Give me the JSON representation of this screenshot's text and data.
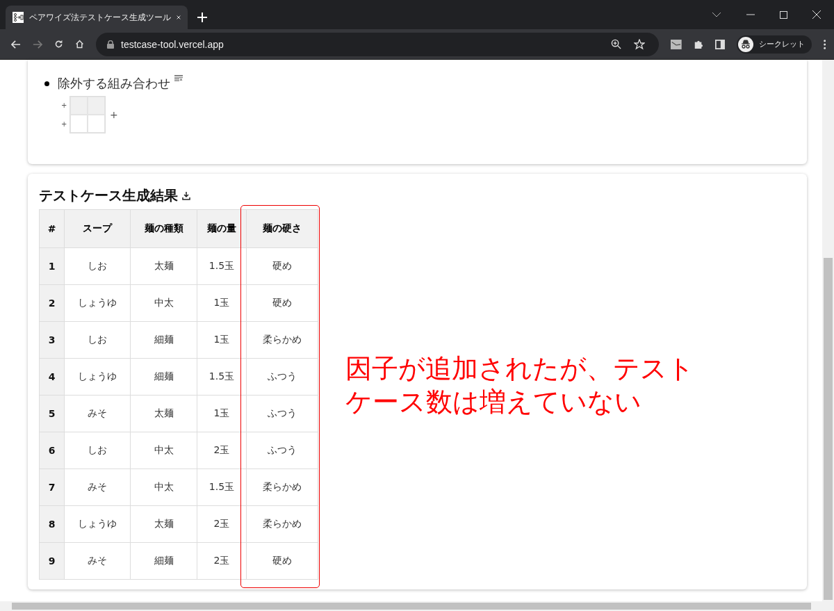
{
  "browser": {
    "tab_title": "ペアワイズ法テストケース生成ツール",
    "url": "testcase-tool.vercel.app",
    "profile": "シークレット"
  },
  "exclusions": {
    "title": "除外する組み合わせ",
    "add_symbol": "+"
  },
  "results": {
    "title": "テストケース生成結果",
    "columns": [
      {
        "label": "#",
        "highlighted": false
      },
      {
        "label": "スープ",
        "highlighted": false
      },
      {
        "label": "麺の種類",
        "highlighted": false
      },
      {
        "label": "麺の量",
        "highlighted": false
      },
      {
        "label": "麺の硬さ",
        "highlighted": true
      }
    ],
    "rows": [
      [
        "1",
        "しお",
        "太麺",
        "1.5玉",
        "硬め"
      ],
      [
        "2",
        "しょうゆ",
        "中太",
        "1玉",
        "硬め"
      ],
      [
        "3",
        "しお",
        "細麺",
        "1玉",
        "柔らかめ"
      ],
      [
        "4",
        "しょうゆ",
        "細麺",
        "1.5玉",
        "ふつう"
      ],
      [
        "5",
        "みそ",
        "太麺",
        "1玉",
        "ふつう"
      ],
      [
        "6",
        "しお",
        "中太",
        "2玉",
        "ふつう"
      ],
      [
        "7",
        "みそ",
        "中太",
        "1.5玉",
        "柔らかめ"
      ],
      [
        "8",
        "しょうゆ",
        "太麺",
        "2玉",
        "柔らかめ"
      ],
      [
        "9",
        "みそ",
        "細麺",
        "2玉",
        "硬め"
      ]
    ]
  },
  "annotation": {
    "lines": [
      "因子が追加されたが、テスト",
      "ケース数は増えていない"
    ]
  }
}
